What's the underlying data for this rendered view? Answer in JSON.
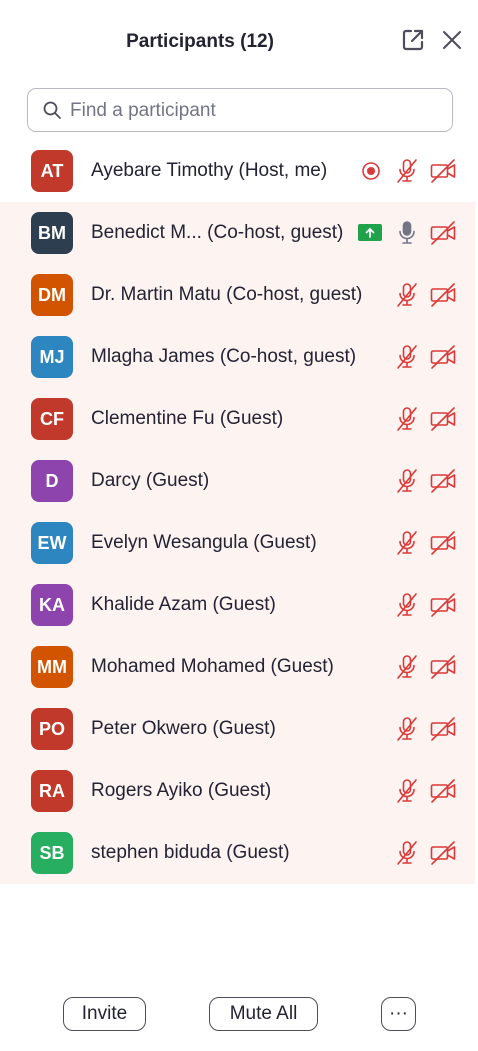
{
  "header": {
    "title": "Participants (12)",
    "popout_icon": "popout-icon",
    "close_icon": "close-icon"
  },
  "search": {
    "placeholder": "Find a participant"
  },
  "colors": {
    "muted_red": "#d93a3a",
    "share_green": "#1fa24a",
    "row_tint": "#fdf3f1"
  },
  "participants": [
    {
      "initials": "AT",
      "name": "Ayebare Timothy (Host, me)",
      "color": "#c0392b",
      "recording": true,
      "mic": "muted",
      "video": "off"
    },
    {
      "initials": "BM",
      "name": "Benedict M...  (Co-host, guest)",
      "color": "#2c3e50",
      "sharing": true,
      "mic": "on",
      "video": "off"
    },
    {
      "initials": "DM",
      "name": "Dr. Martin Matu (Co-host, guest)",
      "color": "#d35400",
      "mic": "muted",
      "video": "off"
    },
    {
      "initials": "MJ",
      "name": "Mlagha James (Co-host, guest)",
      "color": "#2e86c1",
      "mic": "muted",
      "video": "off"
    },
    {
      "initials": "CF",
      "name": "Clementine Fu (Guest)",
      "color": "#c0392b",
      "mic": "muted",
      "video": "off"
    },
    {
      "initials": "D",
      "name": "Darcy (Guest)",
      "color": "#8e44ad",
      "mic": "muted",
      "video": "off"
    },
    {
      "initials": "EW",
      "name": "Evelyn Wesangula (Guest)",
      "color": "#2e86c1",
      "mic": "muted",
      "video": "off"
    },
    {
      "initials": "KA",
      "name": "Khalide Azam (Guest)",
      "color": "#8e44ad",
      "mic": "muted",
      "video": "off"
    },
    {
      "initials": "MM",
      "name": "Mohamed Mohamed (Guest)",
      "color": "#d35400",
      "mic": "muted",
      "video": "off"
    },
    {
      "initials": "PO",
      "name": "Peter Okwero (Guest)",
      "color": "#c0392b",
      "mic": "muted",
      "video": "off"
    },
    {
      "initials": "RA",
      "name": "Rogers Ayiko (Guest)",
      "color": "#c0392b",
      "mic": "muted",
      "video": "off"
    },
    {
      "initials": "SB",
      "name": "stephen biduda (Guest)",
      "color": "#27ae60",
      "mic": "muted",
      "video": "off"
    }
  ],
  "footer": {
    "invite_label": "Invite",
    "mute_all_label": "Mute All",
    "more_label": "···"
  }
}
